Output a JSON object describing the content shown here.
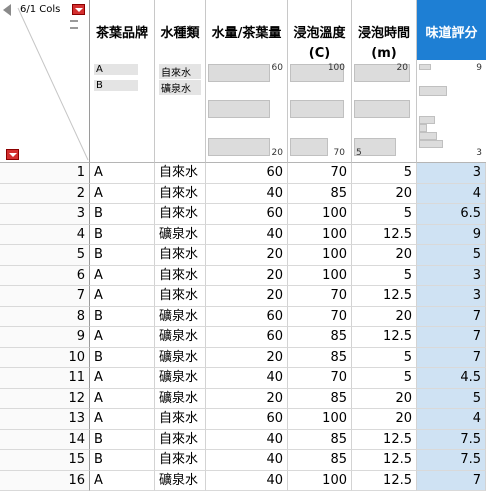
{
  "header": {
    "cols_label": "6/1 Cols",
    "row_count_label": ""
  },
  "columns": [
    {
      "title": "茶葉品牌",
      "type": "nominal",
      "categories": [
        "A",
        "B"
      ]
    },
    {
      "title": "水種類",
      "type": "nominal",
      "categories": [
        "自來水",
        "礦泉水"
      ]
    },
    {
      "title": "水量/茶葉量",
      "type": "continuous",
      "max": "60",
      "min": "20"
    },
    {
      "title": "浸泡溫度\n(C)",
      "type": "continuous",
      "max": "100",
      "min": "70"
    },
    {
      "title": "浸泡時間\n(m)",
      "type": "continuous",
      "max": "20",
      "min": "5"
    },
    {
      "title": "味道評分",
      "type": "continuous",
      "max": "9",
      "min": "3",
      "selected": true
    }
  ],
  "rows": [
    [
      "1",
      "A",
      "自來水",
      "60",
      "70",
      "5",
      "3"
    ],
    [
      "2",
      "A",
      "自來水",
      "40",
      "85",
      "20",
      "4"
    ],
    [
      "3",
      "B",
      "自來水",
      "60",
      "100",
      "5",
      "6.5"
    ],
    [
      "4",
      "B",
      "礦泉水",
      "40",
      "100",
      "12.5",
      "9"
    ],
    [
      "5",
      "B",
      "自來水",
      "20",
      "100",
      "20",
      "5"
    ],
    [
      "6",
      "A",
      "自來水",
      "20",
      "100",
      "5",
      "3"
    ],
    [
      "7",
      "A",
      "自來水",
      "20",
      "70",
      "12.5",
      "3"
    ],
    [
      "8",
      "B",
      "礦泉水",
      "60",
      "70",
      "20",
      "7"
    ],
    [
      "9",
      "A",
      "礦泉水",
      "60",
      "85",
      "12.5",
      "7"
    ],
    [
      "10",
      "B",
      "礦泉水",
      "20",
      "85",
      "5",
      "7"
    ],
    [
      "11",
      "A",
      "礦泉水",
      "40",
      "70",
      "5",
      "4.5"
    ],
    [
      "12",
      "A",
      "礦泉水",
      "20",
      "85",
      "20",
      "5"
    ],
    [
      "13",
      "A",
      "自來水",
      "60",
      "100",
      "20",
      "4"
    ],
    [
      "14",
      "B",
      "自來水",
      "40",
      "85",
      "12.5",
      "7.5"
    ],
    [
      "15",
      "B",
      "自來水",
      "40",
      "85",
      "12.5",
      "7.5"
    ],
    [
      "16",
      "A",
      "礦泉水",
      "40",
      "100",
      "12.5",
      "7"
    ]
  ],
  "colors": {
    "selected_header": "#1e7fd4",
    "selected_cells": "#cfe2f3",
    "red_menu": "#d32f2f"
  }
}
